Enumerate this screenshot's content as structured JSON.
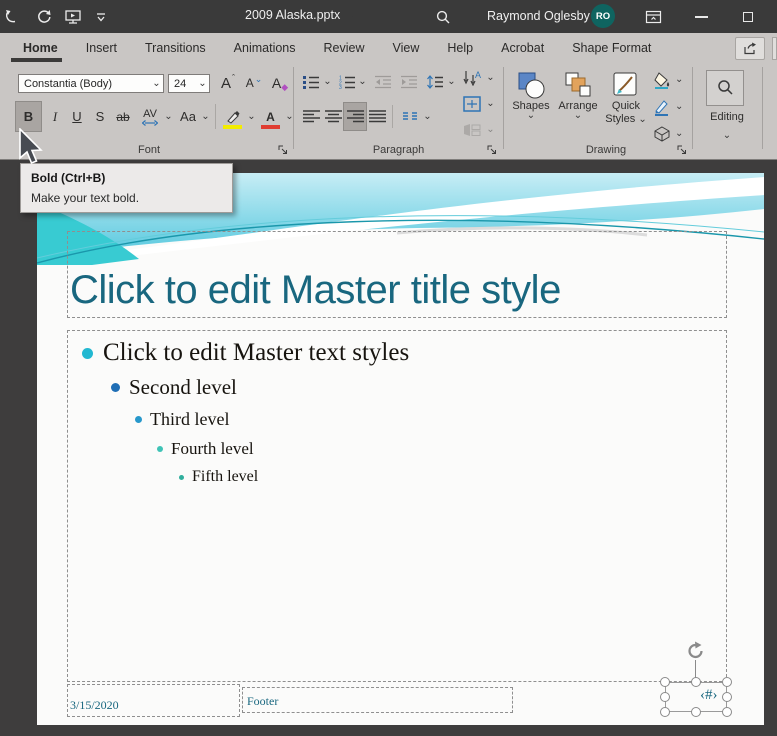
{
  "icons": {
    "chevron_down": "⌄",
    "dropdown_arrow": "⌄"
  },
  "titlebar": {
    "document_title": "2009 Alaska.pptx",
    "user_name": "Raymond Oglesby",
    "user_initials": "RO"
  },
  "tabs": [
    {
      "label": "Home"
    },
    {
      "label": "Insert"
    },
    {
      "label": "Transitions"
    },
    {
      "label": "Animations"
    },
    {
      "label": "Review"
    },
    {
      "label": "View"
    },
    {
      "label": "Help"
    },
    {
      "label": "Acrobat"
    },
    {
      "label": "Shape Format"
    }
  ],
  "ribbon": {
    "font": {
      "group_label": "Font",
      "font_name": "Constantia (Body)",
      "font_size": "24",
      "bold": "B",
      "italic": "I",
      "underline": "U",
      "strike_s": "S",
      "strikethrough": "ab",
      "char_spacing": "AV",
      "change_case": "Aa",
      "grow_shrink_letter": "A",
      "clear_letter": "A",
      "font_color_letter": "A"
    },
    "paragraph": {
      "group_label": "Paragraph"
    },
    "drawing": {
      "group_label": "Drawing",
      "shapes": "Shapes",
      "arrange": "Arrange",
      "quick": "Quick",
      "styles": "Styles"
    },
    "editing": {
      "group_label": "Editing"
    }
  },
  "tooltip": {
    "title": "Bold (Ctrl+B)",
    "description": "Make your text bold."
  },
  "slide": {
    "title_text": "Click to edit Master title style",
    "body": [
      {
        "text": "Click to edit Master text styles",
        "bullet_color": "#22b8d1"
      },
      {
        "text": "Second level",
        "bullet_color": "#1f6eb5"
      },
      {
        "text": "Third level",
        "bullet_color": "#2798cb"
      },
      {
        "text": "Fourth level",
        "bullet_color": "#3fc3b6"
      },
      {
        "text": "Fifth level",
        "bullet_color": "#2fae9c"
      }
    ],
    "date": "3/15/2020",
    "footer": "Footer",
    "slide_number": "‹#›"
  },
  "colors": {
    "accent_teal": "#19677f",
    "wave_cyan": "#55c8de",
    "wave_bright": "#38cbd2",
    "highlight_yellow": "#f3ec00",
    "font_color_red": "#e03c31",
    "avatar_teal": "#0f6460"
  }
}
